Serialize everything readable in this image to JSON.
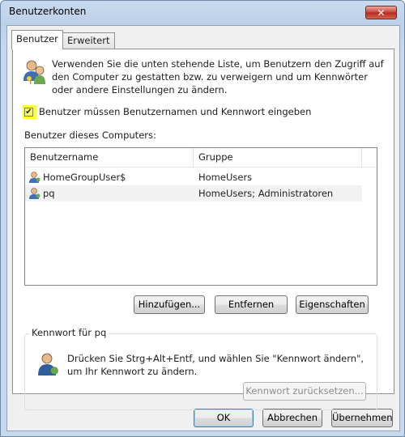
{
  "window": {
    "title": "Benutzerkonten",
    "close_label": "✕"
  },
  "tabs": [
    {
      "label": "Benutzer",
      "active": true
    },
    {
      "label": "Erweitert",
      "active": false
    }
  ],
  "intro_text": "Verwenden Sie die unten stehende Liste, um Benutzern den Zugriff auf den Computer zu gestatten bzw. zu verweigern und um Kennwörter oder andere Einstellungen zu ändern.",
  "require_password": {
    "label": "Benutzer müssen Benutzernamen und Kennwort eingeben",
    "checked": true,
    "check_glyph": "✔"
  },
  "users_label": "Benutzer dieses Computers:",
  "list": {
    "columns": [
      "Benutzername",
      "Gruppe"
    ],
    "rows": [
      {
        "name": "HomeGroupUser$",
        "group": "HomeUsers"
      },
      {
        "name": "pq",
        "group": "HomeUsers; Administratoren"
      }
    ],
    "selected_index": 1
  },
  "actions": {
    "add": "Hinzufügen...",
    "remove": "Entfernen",
    "properties": "Eigenschaften"
  },
  "password_group": {
    "title": "Kennwort für pq",
    "text": "Drücken Sie Strg+Alt+Entf, und wählen Sie \"Kennwort ändern\", um Ihr Kennwort zu ändern.",
    "reset_button": "Kennwort zurücksetzen..."
  },
  "footer": {
    "ok": "OK",
    "cancel": "Abbrechen",
    "apply": "Übernehmen"
  }
}
